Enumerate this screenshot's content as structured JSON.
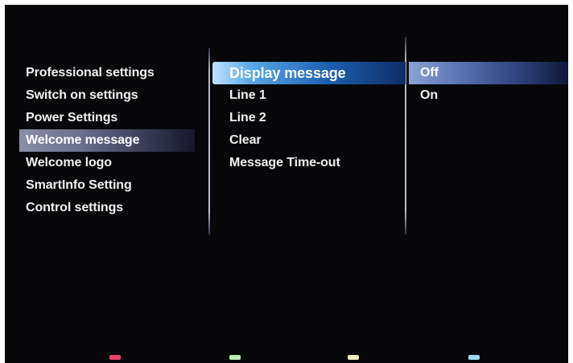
{
  "menu": {
    "level1": [
      {
        "label": "Professional settings"
      },
      {
        "label": "Switch on settings"
      },
      {
        "label": "Power Settings"
      },
      {
        "label": "Welcome message"
      },
      {
        "label": "Welcome logo"
      },
      {
        "label": "SmartInfo Setting"
      },
      {
        "label": "Control settings"
      }
    ],
    "level1_selected": "Welcome message",
    "level2": [
      {
        "label": "Display message"
      },
      {
        "label": "Line 1"
      },
      {
        "label": "Line 2"
      },
      {
        "label": "Clear"
      },
      {
        "label": "Message Time-out"
      }
    ],
    "level2_focused": "Display message",
    "level3": [
      {
        "label": "Off"
      },
      {
        "label": "On"
      }
    ],
    "level3_selected": "Off"
  },
  "color_keys": [
    {
      "name": "red",
      "color": "#e8456a"
    },
    {
      "name": "green",
      "color": "#b9f0b0"
    },
    {
      "name": "yellow",
      "color": "#f2f0c2"
    },
    {
      "name": "blue",
      "color": "#9fd8ef"
    }
  ],
  "colors": {
    "background": "#07070a",
    "text": "#f2f2f2",
    "focus_highlight": "#1d5fb0",
    "selection_grey": "#6a6f8c",
    "selection_blue": "#5c76b5"
  }
}
